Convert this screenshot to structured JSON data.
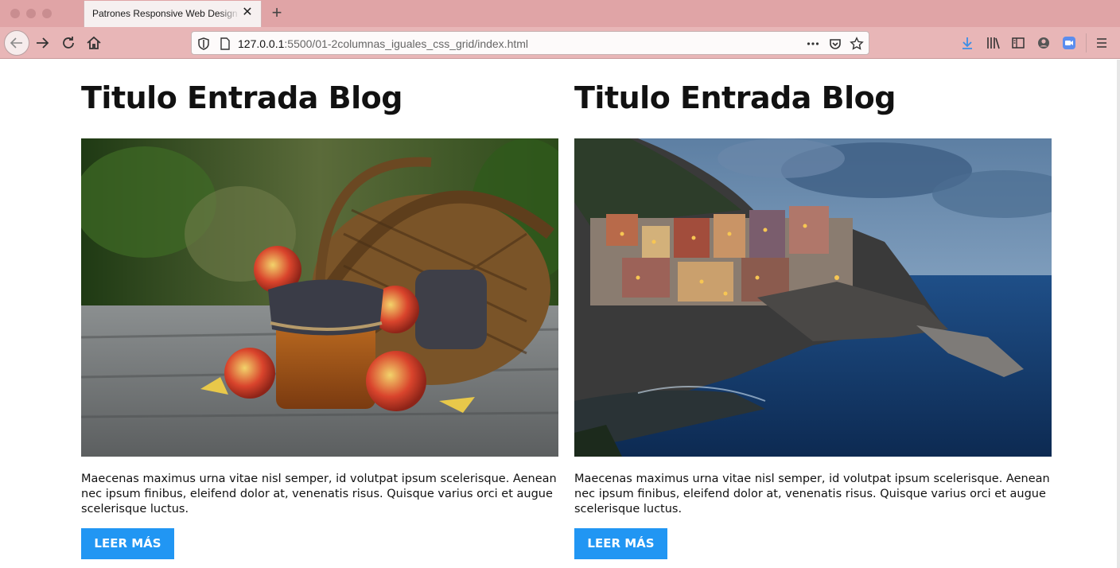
{
  "browser": {
    "tab_title": "Patrones Responsive Web Design - ",
    "url_host": "127.0.0.1",
    "url_path": ":5500/01-2columnas_iguales_css_grid/index.html",
    "icons": [
      "back-icon",
      "forward-icon",
      "reload-icon",
      "home-icon",
      "shield-icon",
      "page-icon",
      "more-icon",
      "pocket-icon",
      "star-icon",
      "download-icon",
      "library-icon",
      "sidebar-icon",
      "account-icon",
      "zoom-icon",
      "menu-icon"
    ]
  },
  "entries": [
    {
      "title": "Titulo Entrada Blog",
      "image": "basket-apples-jam-photo",
      "text": "Maecenas maximus urna vitae nisl semper, id volutpat ipsum scelerisque. Aenean nec ipsum finibus, eleifend dolor at, venenatis risus. Quisque varius orci et augue scelerisque luctus.",
      "button": "LEER MÁS"
    },
    {
      "title": "Titulo Entrada Blog",
      "image": "coastal-village-night-photo",
      "text": "Maecenas maximus urna vitae nisl semper, id volutpat ipsum scelerisque. Aenean nec ipsum finibus, eleifend dolor at, venenatis risus. Quisque varius orci et augue scelerisque luctus.",
      "button": "LEER MÁS"
    }
  ],
  "colors": {
    "accent": "#2196f3",
    "chrome_tab_bar": "#e0a4a6",
    "chrome_nav_bar": "#e8b6b7"
  }
}
